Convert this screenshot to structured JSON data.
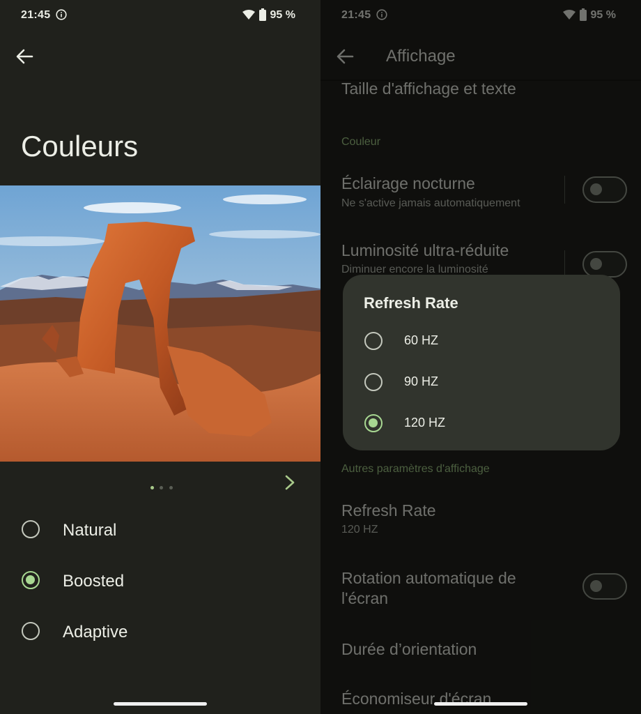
{
  "left": {
    "status": {
      "time": "21:45",
      "battery": "95 %"
    },
    "title": "Couleurs",
    "page_indicator": {
      "count": 3,
      "active": 0
    },
    "options": [
      {
        "label": "Natural",
        "selected": false
      },
      {
        "label": "Boosted",
        "selected": true
      },
      {
        "label": "Adaptive",
        "selected": false
      }
    ]
  },
  "right": {
    "status": {
      "time": "21:45",
      "battery": "95 %"
    },
    "appbar_title": "Affichage",
    "items": {
      "display_size": "Taille d'affichage et texte",
      "section_color": "Couleur",
      "night_light": {
        "title": "Éclairage nocturne",
        "subtitle": "Ne s'active jamais automatiquement",
        "enabled": false
      },
      "extra_dim": {
        "title": "Luminosité ultra-réduite",
        "subtitle": "Diminuer encore la luminosité",
        "enabled": false
      },
      "section_other": "Autres paramètres d'affichage",
      "refresh_rate": {
        "title": "Refresh Rate",
        "subtitle": "120 HZ"
      },
      "auto_rotate": {
        "title_line1": "Rotation automatique de",
        "title_line2": "l'écran",
        "enabled": false
      },
      "orientation_duration": "Durée d’orientation",
      "screensaver": "Économiseur d'écran"
    },
    "dialog": {
      "title": "Refresh Rate",
      "options": [
        {
          "label": "60 HZ",
          "selected": false
        },
        {
          "label": "90 HZ",
          "selected": false
        },
        {
          "label": "120 HZ",
          "selected": true
        }
      ]
    }
  },
  "colors": {
    "background": "#20211c",
    "accent": "#a8d892",
    "dialog": "#31342d"
  }
}
